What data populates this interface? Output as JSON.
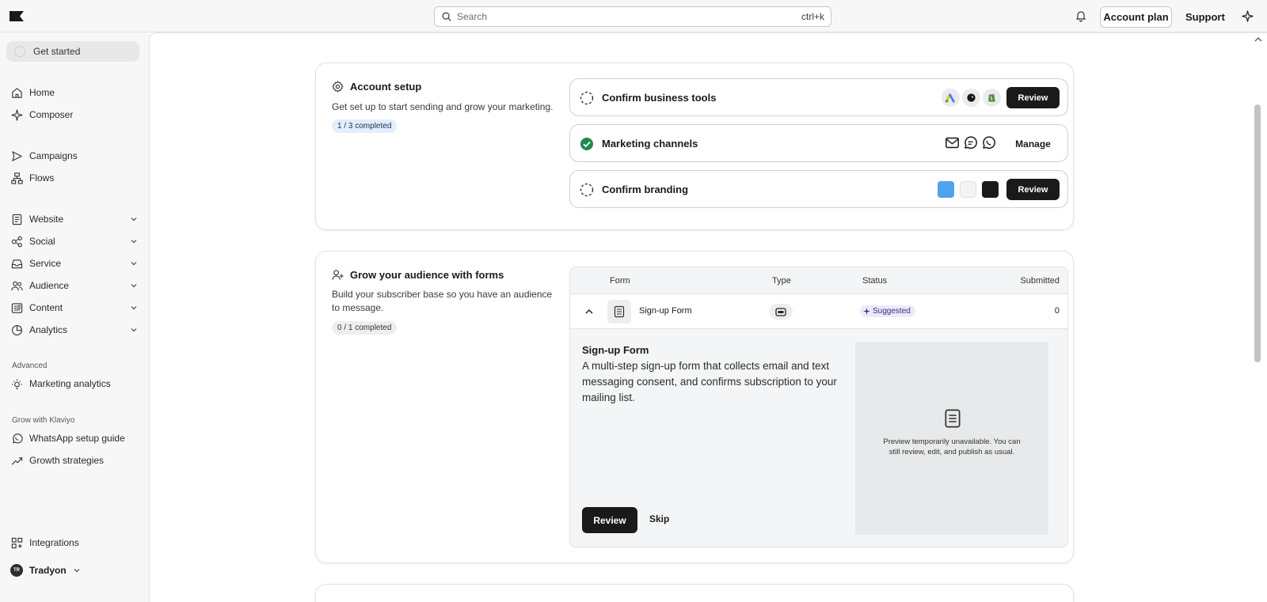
{
  "topbar": {
    "search_placeholder": "Search",
    "search_shortcut": "ctrl+k",
    "account_plan": "Account plan",
    "support": "Support"
  },
  "sidebar": {
    "get_started": "Get started",
    "items": [
      {
        "label": "Home",
        "icon": "home-icon"
      },
      {
        "label": "Composer",
        "icon": "sparkle-icon"
      },
      {
        "label": "Campaigns",
        "icon": "send-icon"
      },
      {
        "label": "Flows",
        "icon": "flows-icon"
      },
      {
        "label": "Website",
        "icon": "document-icon"
      },
      {
        "label": "Social",
        "icon": "social-icon"
      },
      {
        "label": "Service",
        "icon": "inbox-icon"
      },
      {
        "label": "Audience",
        "icon": "people-icon"
      },
      {
        "label": "Content",
        "icon": "content-icon"
      },
      {
        "label": "Analytics",
        "icon": "pie-chart-icon"
      },
      {
        "label": "Marketing analytics",
        "icon": "lightbulb-icon"
      },
      {
        "label": "WhatsApp setup guide",
        "icon": "whatsapp-icon"
      },
      {
        "label": "Growth strategies",
        "icon": "trend-icon"
      },
      {
        "label": "Integrations",
        "icon": "grid-plus-icon"
      }
    ],
    "section_advanced": "Advanced",
    "section_grow": "Grow with Klaviyo",
    "user_initials": "TR",
    "user_name": "Tradyon"
  },
  "account_setup": {
    "title": "Account setup",
    "description": "Get set up to start sending and grow your marketing.",
    "progress": "1 / 3 completed",
    "tasks": [
      {
        "label": "Confirm business tools",
        "status": "pending",
        "action": "Review"
      },
      {
        "label": "Marketing channels",
        "status": "done",
        "action": "Manage"
      },
      {
        "label": "Confirm branding",
        "status": "pending",
        "action": "Review"
      }
    ],
    "brand_colors": [
      "#4ea3ea",
      "#f3f3f4",
      "#1a1a1a"
    ],
    "done_color": "#1f8a4c"
  },
  "forms": {
    "title": "Grow your audience with forms",
    "description": "Build your subscriber base so you have an audience to message.",
    "progress": "0 / 1 completed",
    "columns": [
      "Form",
      "Type",
      "Status",
      "Submitted"
    ],
    "row": {
      "name": "Sign-up Form",
      "status": "Suggested",
      "submitted": "0"
    },
    "detail": {
      "title": "Sign-up Form",
      "description": "A multi-step sign-up form that collects email and text messaging consent, and confirms subscription to your mailing list.",
      "preview_text": "Preview temporarily unavailable. You can still review, edit, and publish as usual.",
      "review": "Review",
      "skip": "Skip"
    }
  }
}
